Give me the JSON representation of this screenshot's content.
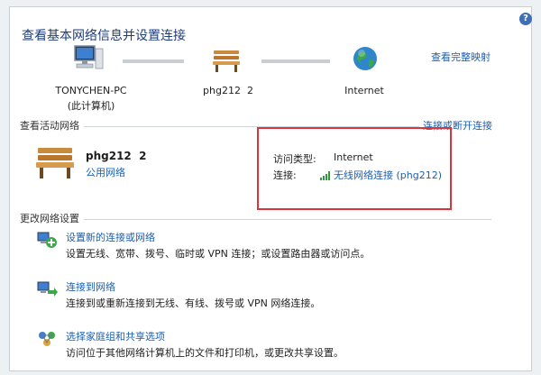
{
  "page": {
    "title": "查看基本网络信息并设置连接",
    "help_glyph": "?",
    "view_full_map": "查看完整映射"
  },
  "map": {
    "computer": {
      "name": "TONYCHEN-PC",
      "sub": "(此计算机)"
    },
    "network": {
      "name": "phg212  2"
    },
    "internet": {
      "name": "Internet"
    }
  },
  "active": {
    "heading": "查看活动网络",
    "toggle_link": "连接或断开连接",
    "network_name": "phg212  2",
    "network_type": "公用网络",
    "access_type_label": "访问类型:",
    "access_type_value": "Internet",
    "connection_label": "连接:",
    "connection_value": "无线网络连接 (phg212)"
  },
  "change": {
    "heading": "更改网络设置",
    "tasks": [
      {
        "title": "设置新的连接或网络",
        "desc": "设置无线、宽带、拨号、临时或 VPN 连接；或设置路由器或访问点。"
      },
      {
        "title": "连接到网络",
        "desc": "连接到或重新连接到无线、有线、拨号或 VPN 网络连接。"
      },
      {
        "title": "选择家庭组和共享选项",
        "desc": "访问位于其他网络计算机上的文件和打印机，或更改共享设置。"
      }
    ]
  },
  "colors": {
    "link": "#1a5fb4",
    "highlight": "#d9353a",
    "title": "#1e3c78"
  }
}
